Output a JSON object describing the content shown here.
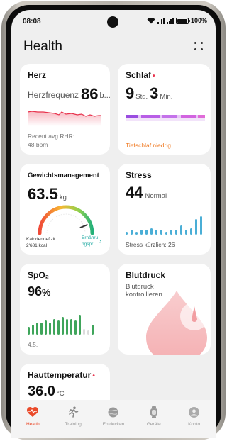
{
  "status_bar": {
    "time": "08:08",
    "battery": "100%"
  },
  "header": {
    "title": "Health",
    "more_icon": "more-grid-icon"
  },
  "cards": {
    "herz": {
      "title": "Herz",
      "label": "Herzfrequenz",
      "value": "86",
      "unit": "b...",
      "foot_line1": "Recent avg RHR:",
      "foot_line2": "48 bpm",
      "color": "#e8344e"
    },
    "schlaf": {
      "title": "Schlaf",
      "hours": "9",
      "hours_unit": "Std.",
      "minutes": "3",
      "minutes_unit": "Min.",
      "note": "Tiefschlaf niedrig",
      "color": "#b44fe0"
    },
    "gewicht": {
      "title": "Gewichtsmanagement",
      "value": "63.5",
      "unit": "kg",
      "foot_left_line1": "Kaloriendefizit",
      "foot_left_line2": "2'681 kcal",
      "foot_right_line1": "Ernähru",
      "foot_right_line2": "ngspr...",
      "level": 0.88
    },
    "stress": {
      "title": "Stress",
      "value": "44",
      "label": "Normal",
      "foot": "Stress kürzlich: 26",
      "bars": [
        2,
        3,
        2,
        3,
        3,
        4,
        3,
        3,
        2,
        3,
        3,
        6,
        3,
        4,
        10,
        12
      ],
      "color": "#4aaed6"
    },
    "spo2": {
      "title": "SpO₂",
      "value": "96",
      "unit": "%",
      "foot": "4.5.",
      "bars": [
        4,
        5,
        6,
        6,
        7,
        6,
        8,
        7,
        9,
        8,
        8,
        7,
        10,
        3,
        2,
        5
      ],
      "color": "#3fa55b"
    },
    "blutdruck": {
      "title": "Blutdruck",
      "sub_line1": "Blutdruck",
      "sub_line2": "kontrollieren",
      "color": "#f3a2a5"
    },
    "haut": {
      "title": "Hauttemperatur",
      "value": "36.0",
      "unit": "°C"
    }
  },
  "nav": [
    {
      "label": "Health",
      "icon": "heart-pulse-icon",
      "active": true
    },
    {
      "label": "Training",
      "icon": "running-icon",
      "active": false
    },
    {
      "label": "Entdecken",
      "icon": "planet-icon",
      "active": false
    },
    {
      "label": "Geräte",
      "icon": "watch-icon",
      "active": false
    },
    {
      "label": "Konto",
      "icon": "person-icon",
      "active": false
    }
  ]
}
